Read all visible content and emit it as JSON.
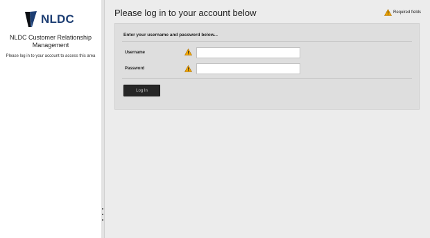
{
  "sidebar": {
    "logo_text": "NLDC",
    "app_title": "NLDC Customer Relationship Management",
    "message": "Please log in to your account to access this area"
  },
  "header": {
    "title": "Please log in to your account below",
    "required_label": "Required fields"
  },
  "form": {
    "heading": "Enter your username and password below...",
    "username_label": "Username",
    "username_value": "",
    "password_label": "Password",
    "password_value": "",
    "submit_label": "Log In"
  },
  "colors": {
    "logo_blue": "#1d3e73",
    "warning": "#f0a500",
    "button": "#262626"
  },
  "icons": {
    "logo": "nldc-logo-icon",
    "required": "warning-icon"
  }
}
